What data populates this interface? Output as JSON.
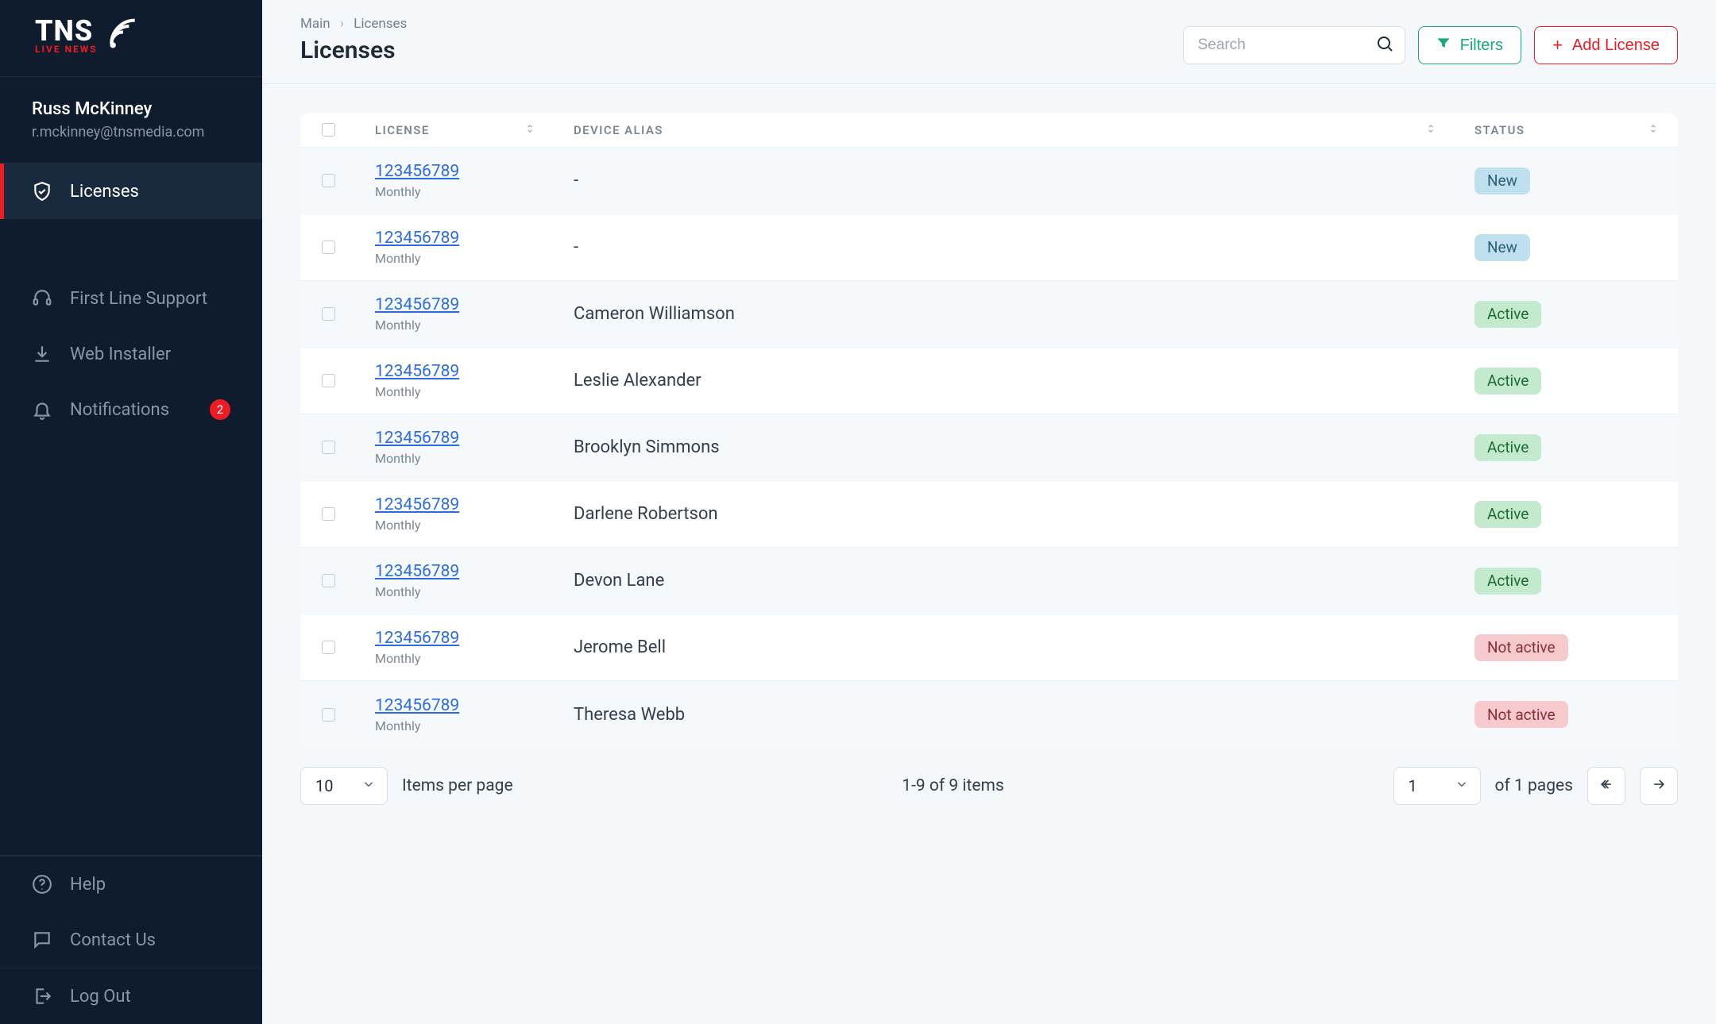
{
  "brand": {
    "name": "TNS",
    "sub": "LIVE NEWS"
  },
  "user": {
    "name": "Russ McKinney",
    "email": "r.mckinney@tnsmedia.com"
  },
  "sidebar": {
    "licenses": "Licenses",
    "support": "First Line Support",
    "installer": "Web Installer",
    "notifications": "Notifications",
    "notifications_badge": "2",
    "help": "Help",
    "contact": "Contact Us",
    "logout": "Log Out"
  },
  "breadcrumb": {
    "root": "Main",
    "current": "Licenses"
  },
  "page": {
    "title": "Licenses"
  },
  "search": {
    "placeholder": "Search"
  },
  "actions": {
    "filters": "Filters",
    "add": "Add License"
  },
  "table": {
    "headers": {
      "license": "LICENSE",
      "device": "DEVICE ALIAS",
      "status": "STATUS"
    },
    "rows": [
      {
        "id": "123456789",
        "plan": "Monthly",
        "alias": "-",
        "status": "New",
        "status_kind": "new"
      },
      {
        "id": "123456789",
        "plan": "Monthly",
        "alias": "-",
        "status": "New",
        "status_kind": "new"
      },
      {
        "id": "123456789",
        "plan": "Monthly",
        "alias": "Cameron Williamson",
        "status": "Active",
        "status_kind": "active"
      },
      {
        "id": "123456789",
        "plan": "Monthly",
        "alias": "Leslie Alexander",
        "status": "Active",
        "status_kind": "active"
      },
      {
        "id": "123456789",
        "plan": "Monthly",
        "alias": "Brooklyn Simmons",
        "status": "Active",
        "status_kind": "active"
      },
      {
        "id": "123456789",
        "plan": "Monthly",
        "alias": "Darlene Robertson",
        "status": "Active",
        "status_kind": "active"
      },
      {
        "id": "123456789",
        "plan": "Monthly",
        "alias": "Devon Lane",
        "status": "Active",
        "status_kind": "active"
      },
      {
        "id": "123456789",
        "plan": "Monthly",
        "alias": "Jerome Bell",
        "status": "Not active",
        "status_kind": "notactive"
      },
      {
        "id": "123456789",
        "plan": "Monthly",
        "alias": "Theresa Webb",
        "status": "Not active",
        "status_kind": "notactive"
      }
    ]
  },
  "pagination": {
    "per_page": "10",
    "per_page_label": "Items per page",
    "range": "1-9 of 9 items",
    "page": "1",
    "pages_label": "of 1 pages"
  }
}
